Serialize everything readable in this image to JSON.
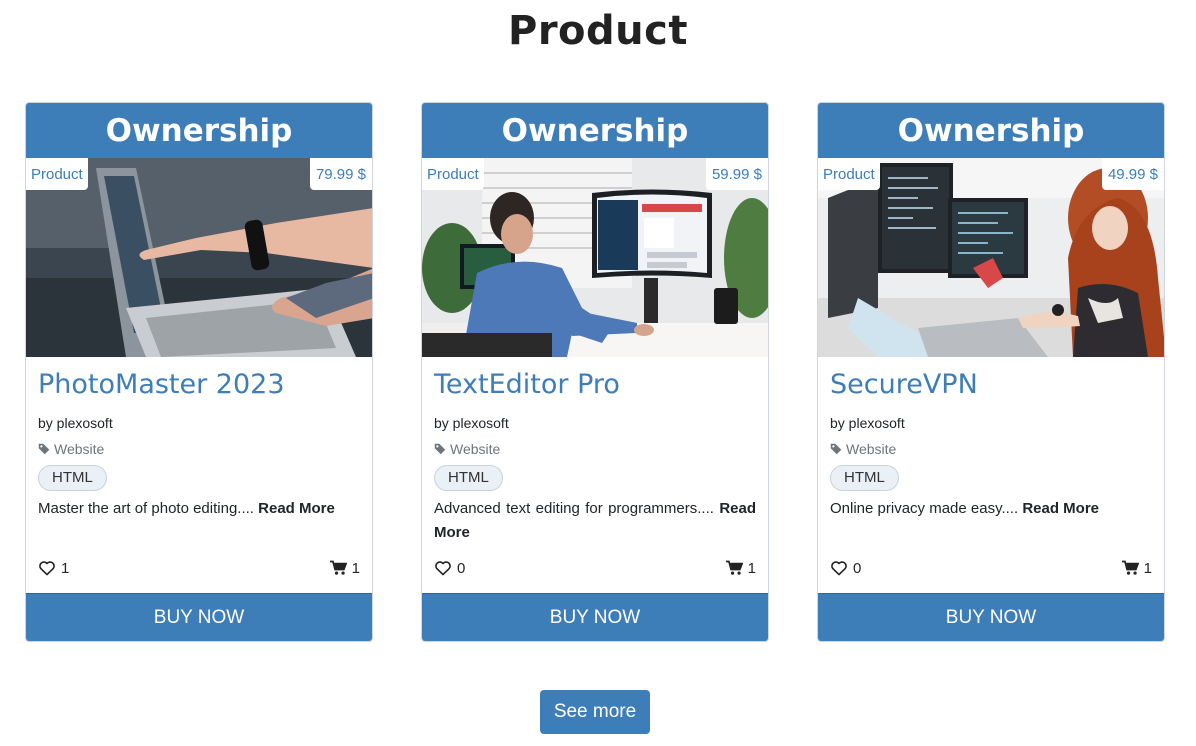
{
  "page": {
    "title": "Product"
  },
  "cards": [
    {
      "header": "Ownership",
      "tag": "Product",
      "price": "79.99 $",
      "name": "PhotoMaster 2023",
      "author": "by plexosoft",
      "category": "Website",
      "badge": "HTML",
      "description": "Master the art of photo editing....",
      "read_more": "Read More",
      "likes": "1",
      "cart": "1",
      "buy_label": "BUY NOW"
    },
    {
      "header": "Ownership",
      "tag": "Product",
      "price": "59.99 $",
      "name": "TextEditor Pro",
      "author": "by plexosoft",
      "category": "Website",
      "badge": "HTML",
      "description": "Advanced text editing for programmers....",
      "read_more": "Read More",
      "likes": "0",
      "cart": "1",
      "buy_label": "BUY NOW"
    },
    {
      "header": "Ownership",
      "tag": "Product",
      "price": "49.99 $",
      "name": "SecureVPN",
      "author": "by plexosoft",
      "category": "Website",
      "badge": "HTML",
      "description": "Online privacy made easy....",
      "read_more": "Read More",
      "likes": "0",
      "cart": "1",
      "buy_label": "BUY NOW"
    }
  ],
  "see_more": {
    "label": "See more"
  },
  "icons": {
    "like": "heart-outline-icon",
    "cart": "shopping-cart-icon",
    "category": "tag-icon"
  },
  "colors": {
    "primary": "#3d7db8",
    "text": "#212529",
    "muted": "#6c757d"
  }
}
